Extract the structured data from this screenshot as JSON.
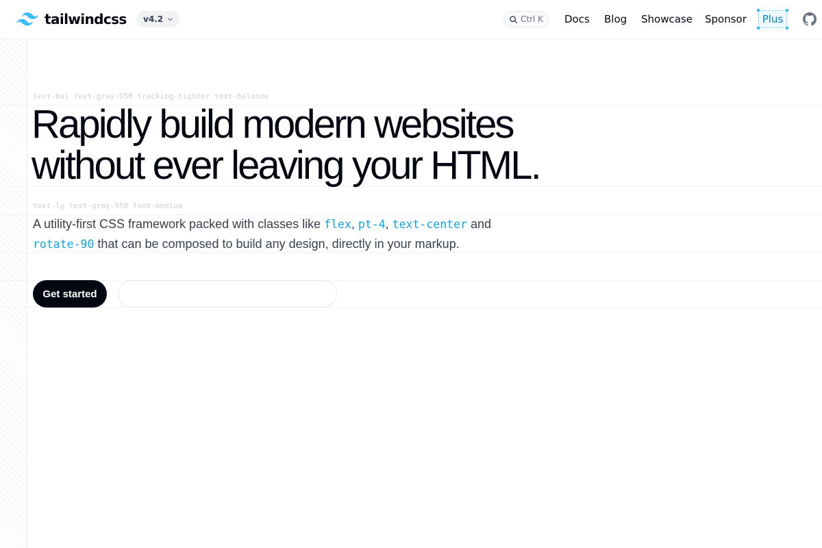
{
  "header": {
    "brand_name": "tailwindcss",
    "version": "v4.2",
    "search_shortcut": "Ctrl K",
    "nav": [
      {
        "label": "Docs"
      },
      {
        "label": "Blog"
      },
      {
        "label": "Showcase"
      },
      {
        "label": "Sponsor"
      }
    ],
    "plus_label": "Plus"
  },
  "hero": {
    "headline_class_hint": "text-6xl text-gray-950 tracking-tighter text-balance",
    "headline_line1": "Rapidly build modern websites",
    "headline_line2": "without ever leaving your HTML.",
    "lede_class_hint": "text-lg text-gray-950 font-medium",
    "lede": {
      "part1": "A utility-first CSS framework packed with classes like ",
      "code1": "flex",
      "sep1": ", ",
      "code2": "pt-4",
      "sep2": ", ",
      "code3": "text-center",
      "sep3": " and",
      "code4": "rotate-90",
      "part2": " that can be composed to build any design, directly in your markup."
    },
    "primary_cta": "Get started"
  },
  "colors": {
    "brand": "#38bdf8",
    "code": "#0ea5e9",
    "text": "#030712",
    "primary_button": "#030712"
  },
  "icons": [
    "tailwind-logo-icon",
    "chevron-down-icon",
    "search-icon",
    "github-icon"
  ]
}
